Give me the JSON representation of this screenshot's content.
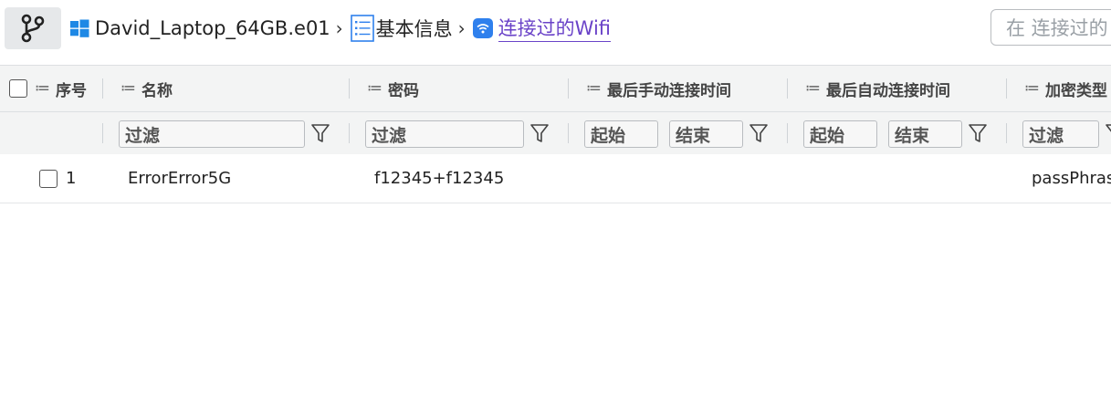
{
  "breadcrumb": {
    "items": [
      "David_Laptop_64GB.e01",
      "基本信息",
      "连接过的Wifi"
    ],
    "separator": "›"
  },
  "search": {
    "placeholder": "在 连接过的"
  },
  "table": {
    "columns": [
      "序号",
      "名称",
      "密码",
      "最后手动连接时间",
      "最后自动连接时间",
      "加密类型"
    ],
    "filters": {
      "text_placeholder": "过滤",
      "start_placeholder": "起始",
      "end_placeholder": "结束"
    },
    "rows": [
      {
        "index": "1",
        "name": "ErrorError5G",
        "password": "f12345+f12345",
        "manual_time": "",
        "auto_time": "",
        "encryption": "passPhrase"
      }
    ]
  },
  "colors": {
    "accent": "#6a43c8",
    "windows_blue": "#1e88e5",
    "wifi_blue": "#2f80ed",
    "header_bg": "#f3f4f4"
  },
  "icons": [
    "branch-icon",
    "windows-icon",
    "list-icon",
    "wifi-icon",
    "filter-icon",
    "column-menu-icon",
    "checkbox-icon"
  ]
}
